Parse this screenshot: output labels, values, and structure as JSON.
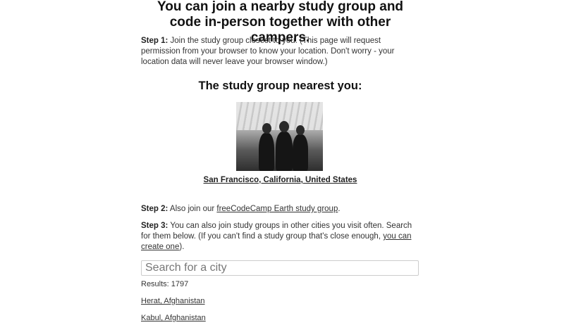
{
  "heading": "You can join a nearby study group and code in-person together with other campers.",
  "step1": {
    "label": "Step 1:",
    "text": " Join the study group closest to you. (This page will request permission from your browser to know your location. Don't worry - your location data will never leave your browser window.)"
  },
  "nearest": {
    "heading": "The study group nearest you:",
    "city_link": "San Francisco, California, United States"
  },
  "step2": {
    "label": "Step 2:",
    "text_before": " Also join our ",
    "link": "freeCodeCamp Earth study group",
    "text_after": "."
  },
  "step3": {
    "label": "Step 3:",
    "text_before": " You can also join study groups in other cities you visit often. Search for them below. (If you can't find a study group that's close enough, ",
    "link": "you can create one",
    "text_after": ")."
  },
  "search": {
    "placeholder": "Search for a city",
    "value": ""
  },
  "results": {
    "label": "Results: 1797",
    "items": [
      "Herat, Afghanistan",
      "Kabul, Afghanistan"
    ]
  }
}
